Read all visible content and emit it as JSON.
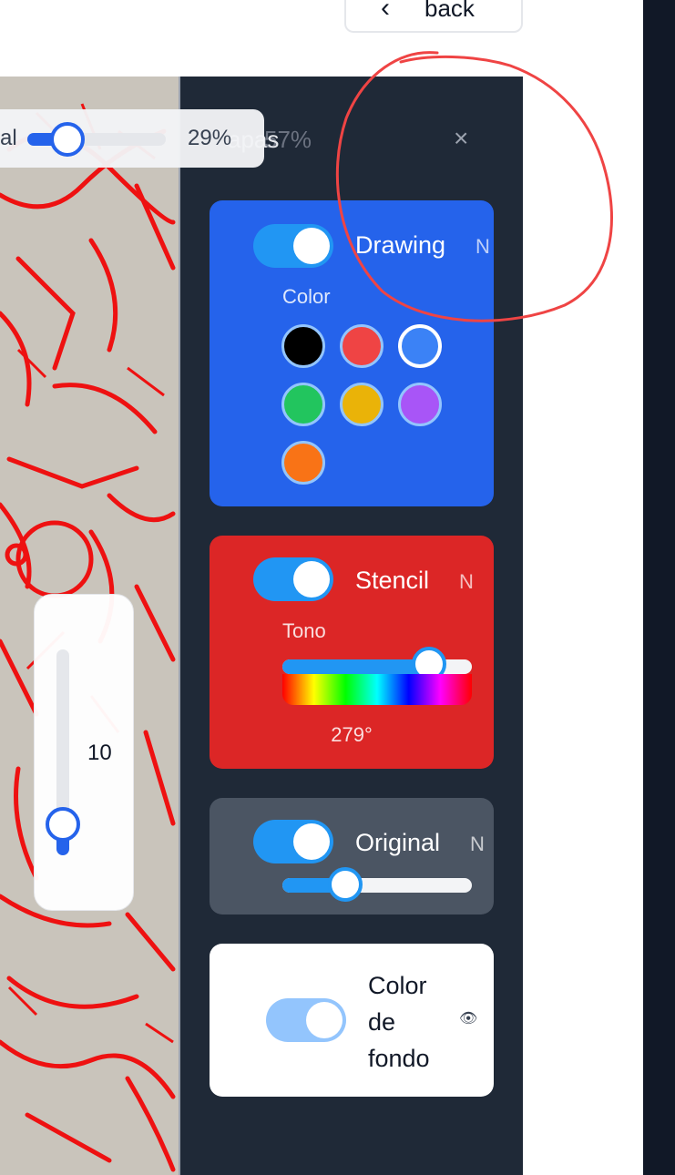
{
  "header": {
    "back_label": "back",
    "back_icon": "chevron-left-icon"
  },
  "canvas_toolbar": {
    "opacity_label": "al",
    "opacity_value": 0.29,
    "opacity_text": "29%"
  },
  "brush": {
    "size_text": "10",
    "level": 0.15
  },
  "layers_panel": {
    "title": "apas",
    "title_ghost": "57%",
    "close_icon": "close-icon",
    "close_symbol": "×",
    "layers": [
      {
        "id": "drawing",
        "label": "Drawing",
        "badge": "N",
        "enabled": true,
        "sub_label": "Color",
        "colors": [
          "#000000",
          "#ef4444",
          "#3b82f6",
          "#22c55e",
          "#eab308",
          "#a855f7",
          "#f97316"
        ],
        "selected_color": "#3b82f6"
      },
      {
        "id": "stencil",
        "label": "Stencil",
        "badge": "N",
        "enabled": true,
        "sub_label": "Tono",
        "hue_degrees": 279,
        "hue_text": "279°"
      },
      {
        "id": "original",
        "label": "Original",
        "badge": "N",
        "enabled": true,
        "opacity": 0.33
      },
      {
        "id": "background",
        "label": "Color de fondo",
        "enabled": true,
        "icon": "eye-icon",
        "icon_symbol": "👁"
      }
    ]
  },
  "colors": {
    "panel_bg": "#1f2937",
    "drawing_card": "#2563eb",
    "stencil_card": "#dc2626",
    "original_card": "#4b5563",
    "toggle_on": "#2196f3",
    "annotation": "#ef4444"
  }
}
